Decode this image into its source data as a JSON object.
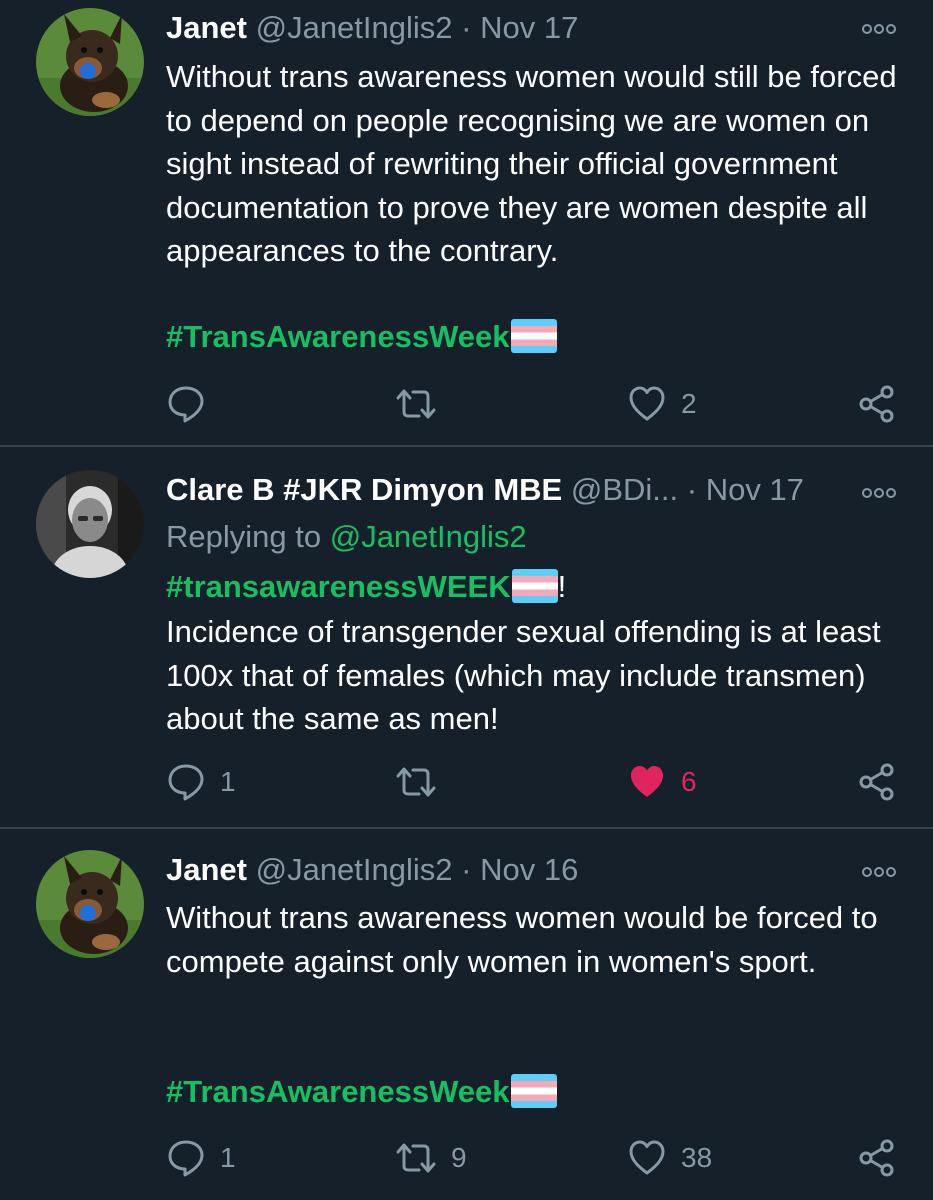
{
  "colors": {
    "background": "#15202b",
    "divider": "#38444d",
    "text": "#ffffff",
    "muted": "#8899a6",
    "accent": "#17bf63",
    "like_active": "#e0245e"
  },
  "tweets": [
    {
      "name": "Janet",
      "handle": "@JanetInglis2",
      "separator": "·",
      "date": "Nov 17",
      "avatar": "dog-avatar",
      "text": "Without trans awareness women would still be forced to depend on people recognising we are women on sight instead of rewriting their official government documentation to prove they are women despite all appearances to the contrary.",
      "hashtag": "#TransAwarenessWeek",
      "hashtag_suffix": "",
      "flag_icon": "transgender-flag-emoji",
      "actions": {
        "reply_icon": "reply-icon",
        "reply_count": "",
        "retweet_icon": "retweet-icon",
        "retweet_count": "",
        "like_icon": "heart-outline-icon",
        "like_count": "2",
        "share_icon": "share-icon"
      }
    },
    {
      "name": "Clare B #JKR Dimyon MBE",
      "handle": "@BDi...",
      "separator": "·",
      "date": "Nov 17",
      "avatar": "person-photo-avatar",
      "replying_label": "Replying to",
      "replying_handle": "@JanetInglis2",
      "hashtag": "#transawarenessWEEK",
      "hashtag_suffix": "!",
      "flag_icon": "transgender-flag-emoji",
      "text": "Incidence of transgender sexual offending is at least 100x that of females (which may include transmen) about the same as men!",
      "actions": {
        "reply_icon": "reply-icon",
        "reply_count": "1",
        "retweet_icon": "retweet-icon",
        "retweet_count": "",
        "like_icon": "heart-filled-icon",
        "like_count": "6",
        "share_icon": "share-icon"
      }
    },
    {
      "name": "Janet",
      "handle": "@JanetInglis2",
      "separator": "·",
      "date": "Nov 16",
      "avatar": "dog-avatar",
      "text": "Without trans awareness women would be forced to compete against only women in women's sport.",
      "hashtag": "#TransAwarenessWeek",
      "hashtag_suffix": "",
      "flag_icon": "transgender-flag-emoji",
      "actions": {
        "reply_icon": "reply-icon",
        "reply_count": "1",
        "retweet_icon": "retweet-icon",
        "retweet_count": "9",
        "like_icon": "heart-outline-icon",
        "like_count": "38",
        "share_icon": "share-icon"
      }
    }
  ]
}
